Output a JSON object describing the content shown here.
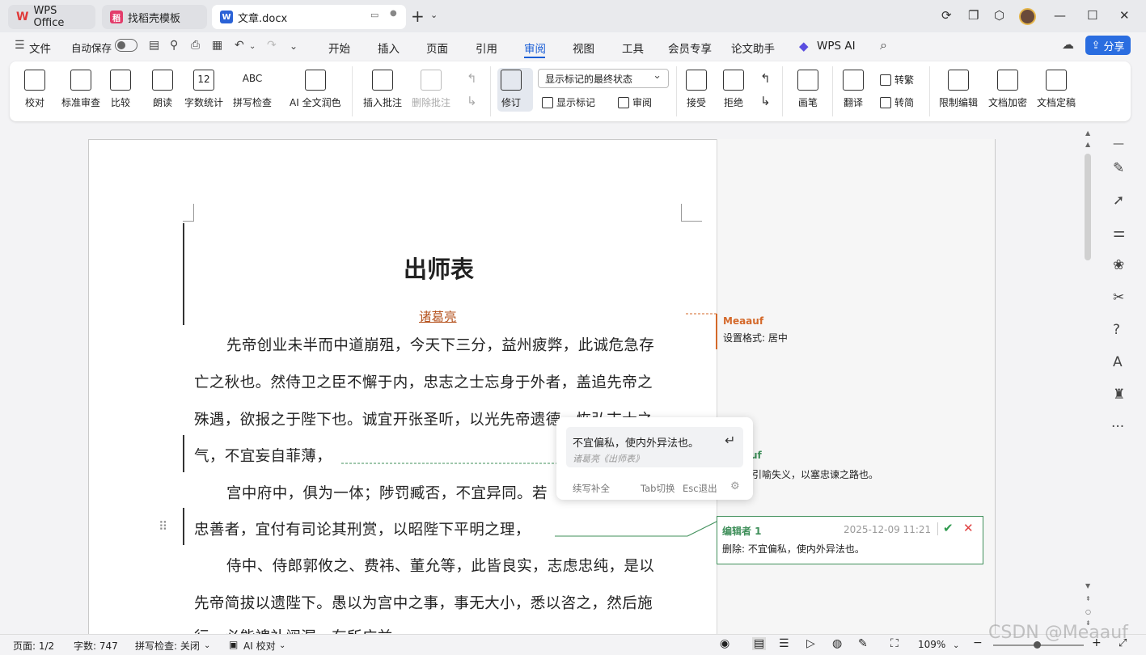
{
  "tabs": [
    {
      "label": "WPS Office",
      "icon": "wps-logo-icon"
    },
    {
      "label": "找稻壳模板",
      "icon": "docer-icon"
    },
    {
      "label": "文章.docx",
      "icon": "word-doc-icon"
    }
  ],
  "menubar": {
    "file": "文件",
    "autosave": "自动保存",
    "items": [
      "开始",
      "插入",
      "页面",
      "引用",
      "审阅",
      "视图",
      "工具",
      "会员专享",
      "论文助手",
      "WPS AI"
    ],
    "share": "分享"
  },
  "ribbon": {
    "proofread": "校对",
    "standard_review": "标准审查",
    "compare": "比较",
    "read_aloud": "朗读",
    "word_count": "字数统计",
    "spell_check": "拼写检查",
    "ai_polish": "AI 全文润色",
    "insert_comment": "插入批注",
    "delete_comment": "删除批注",
    "track_changes": "修订",
    "markup_state": "显示标记的最终状态",
    "show_markup": "显示标记",
    "review_pane": "审阅",
    "accept": "接受",
    "reject": "拒绝",
    "pen": "画笔",
    "translate": "翻译",
    "to_traditional": "转繁",
    "to_simplified": "转简",
    "restrict_edit": "限制编辑",
    "doc_encrypt": "文档加密",
    "doc_finalize": "文档定稿",
    "spell_icon_text": "ABC",
    "word_count_icon_text": "12"
  },
  "document": {
    "title": "出师表",
    "author": "诸葛亮",
    "lines": [
      "先帝创业未半而中道崩殂，今天下三分，益州疲弊，此诚危急存",
      "亡之秋也。然侍卫之臣不懈于内，忠志之士忘身于外者，盖追先帝之",
      "殊遇，欲报之于陛下也。诚宜开张圣听，以光先帝遗德，恢弘志士之",
      "气，不宜妄自菲薄，",
      "宫中府中，俱为一体；陟罚臧否，不宜异同。若",
      "忠善者，宜付有司论其刑赏，以昭陛下平明之理，",
      "侍中、侍郎郭攸之、费祎、董允等，此皆良实，志虑忠纯，是以",
      "先帝简拔以遗陛下。愚以为宫中之事，事无大小，悉以咨之，然后施",
      "行，必能裨补阙漏，有所广益。"
    ]
  },
  "comments": [
    {
      "author": "Meaauf",
      "text": "设置格式: 居中",
      "color": "#d4692a"
    },
    {
      "author": "uf",
      "text": "引喻失义，以塞忠谏之路也。",
      "color": "#3f8f5a"
    },
    {
      "author": "编辑者 1",
      "date": "2025-12-09 11:21",
      "text": "删除: 不宜偏私，使内外异法也。",
      "color": "#3f8f5a"
    }
  ],
  "popup": {
    "suggestion": "不宜偏私，使内外异法也。",
    "source": "诸葛亮《出师表》",
    "continue": "续写补全",
    "tab_hint": "Tab切换",
    "esc_hint": "Esc退出"
  },
  "status": {
    "page": "页面: 1/2",
    "words": "字数: 747",
    "spell": "拼写检查: 关闭",
    "ai_proof": "AI 校对",
    "zoom": "109%"
  },
  "watermark": "CSDN @Meaauf"
}
